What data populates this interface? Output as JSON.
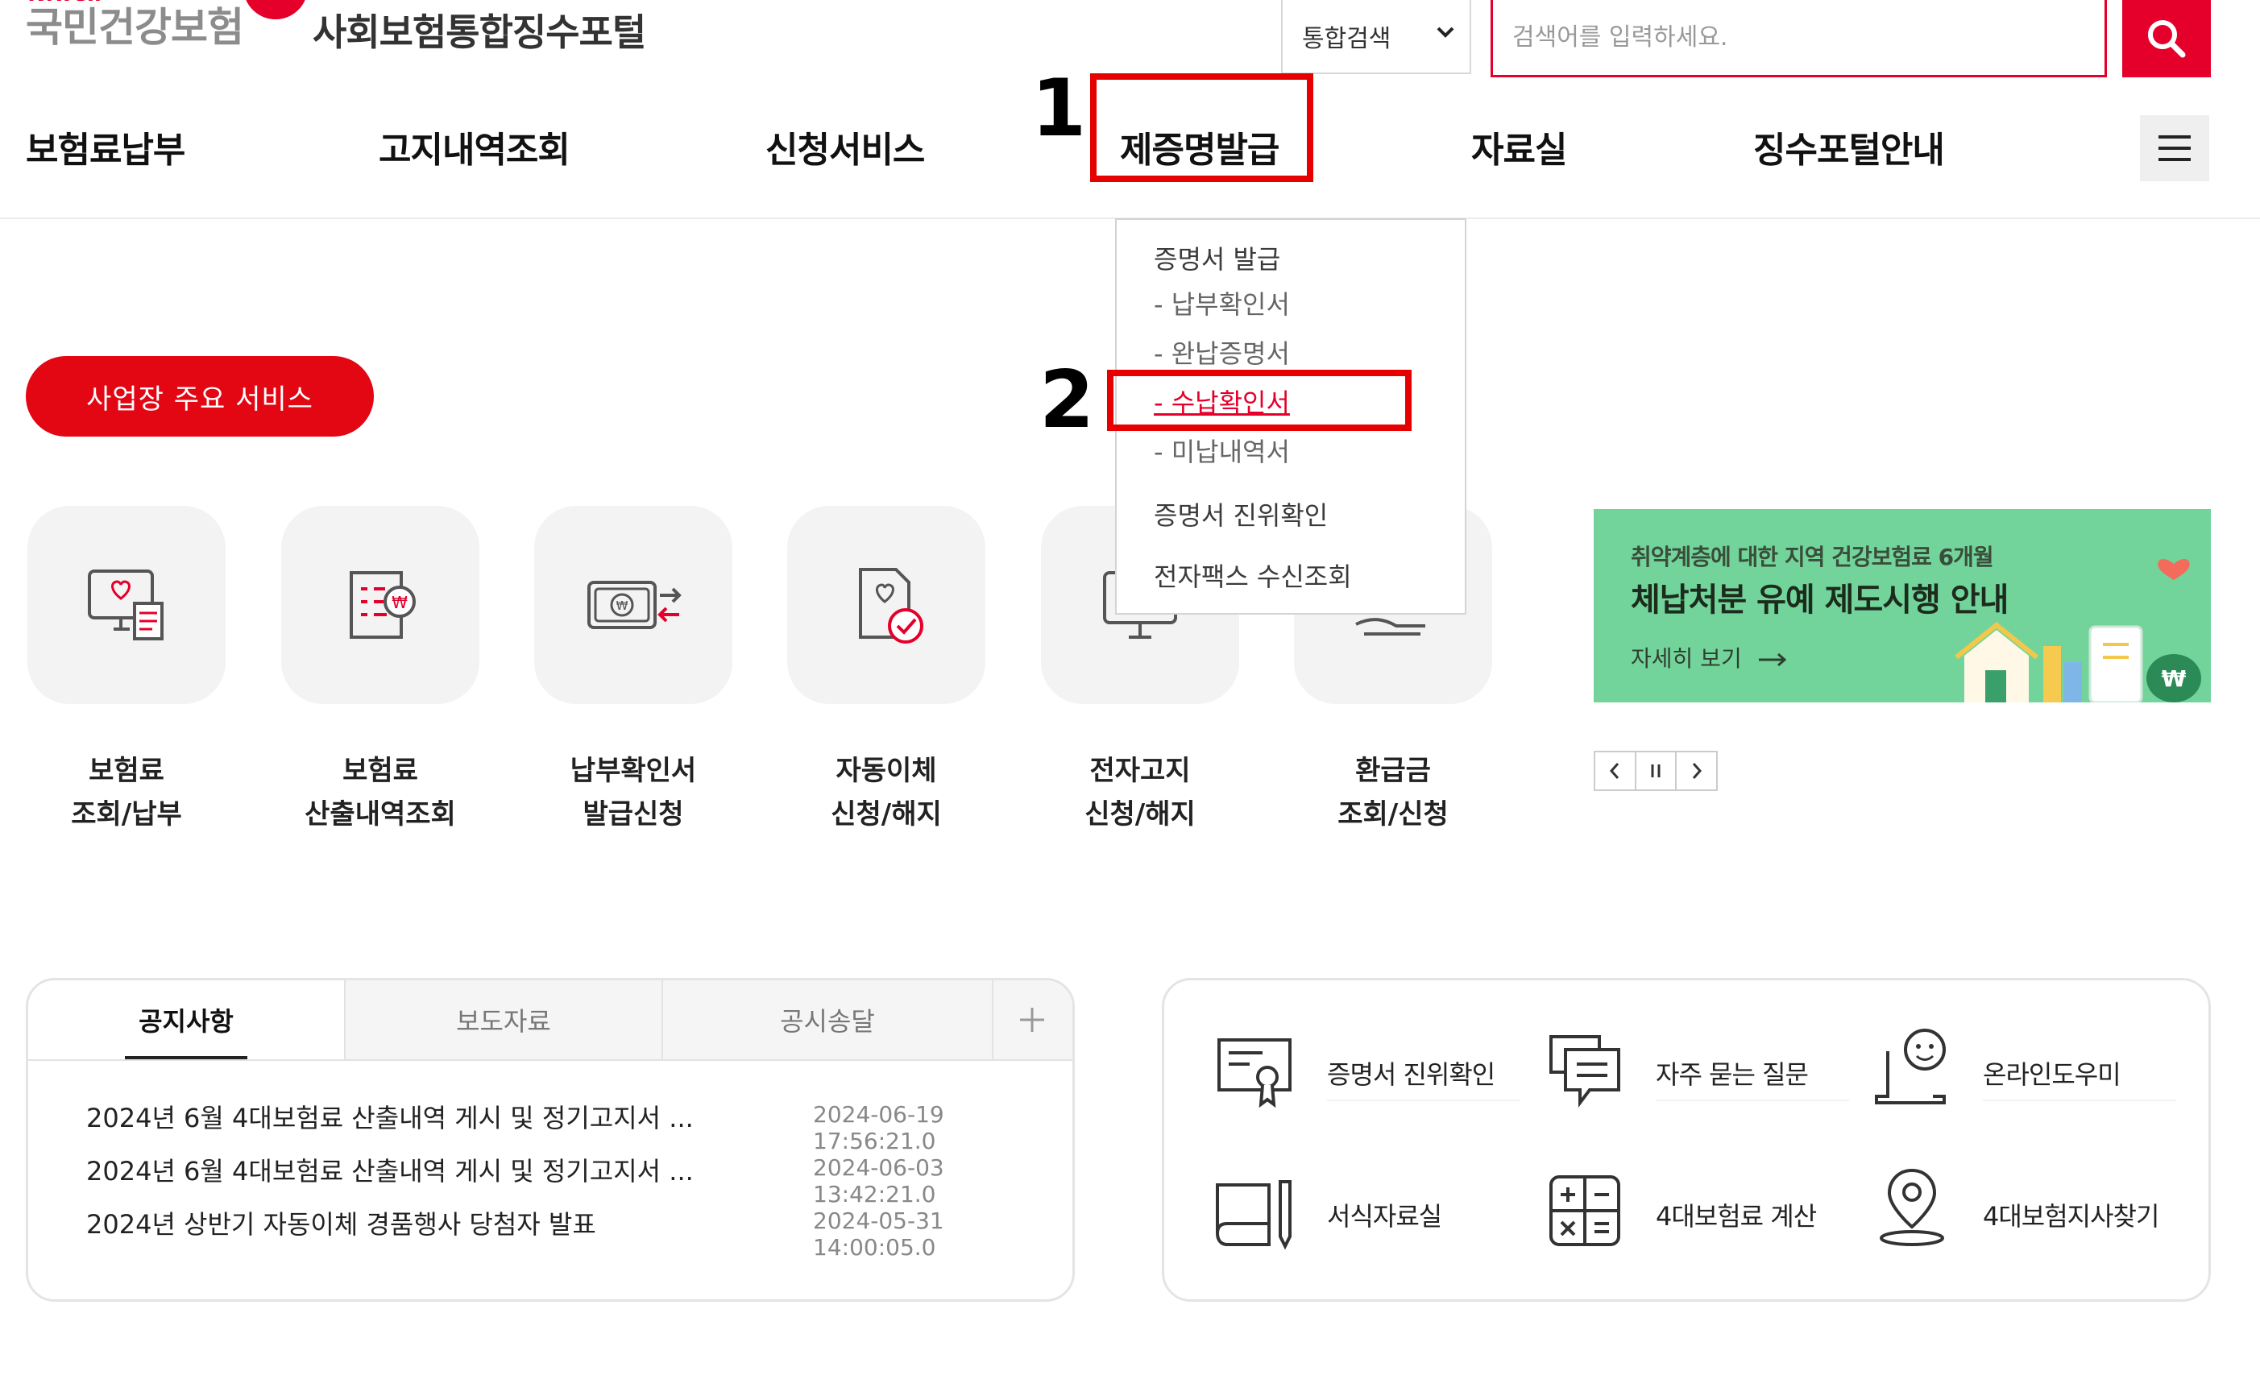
{
  "header": {
    "logo_small": "N.well",
    "logo_text": "국민건강보험",
    "portal_title": "사회보험통합징수포털",
    "search_scope": "통합검색",
    "search_placeholder": "검색어를 입력하세요.",
    "search_icon": "search-icon",
    "menu_icon": "hamburger-menu-icon"
  },
  "nav": {
    "items": [
      "보험료납부",
      "고지내역조회",
      "신청서비스",
      "제증명발급",
      "자료실",
      "징수포털안내"
    ]
  },
  "annotations": {
    "step1": "1",
    "step2": "2",
    "color": "#e60000"
  },
  "dropdown": {
    "section1": "증명서 발급",
    "items": [
      "- 납부확인서",
      "- 완납증명서",
      "- 수납확인서",
      "- 미납내역서"
    ],
    "selected": "- 수납확인서",
    "section2": "증명서 진위확인",
    "section3": "전자팩스 수신조회"
  },
  "service_button": "사업장 주요 서비스",
  "services": [
    {
      "label": "보험료\n조회/납부",
      "icon": "monitor-heart-receipt-icon"
    },
    {
      "label": "보험료\n산출내역조회",
      "icon": "document-won-icon"
    },
    {
      "label": "납부확인서\n발급신청",
      "icon": "card-won-transfer-icon"
    },
    {
      "label": "자동이체\n신청/해지",
      "icon": "document-heart-check-icon"
    },
    {
      "label": "전자고지\n신청/해지",
      "icon": "computer-monitor-icon"
    },
    {
      "label": "환급금\n조회/신청",
      "icon": "refund-hand-icon"
    }
  ],
  "banner": {
    "subtitle": "취약계층에 대한 지역 건강보험료 6개월",
    "title": "체납처분 유예 제도시행 안내",
    "more": "자세히 보기",
    "bg_color": "#72d49b",
    "controls": [
      "chevron-left-icon",
      "pause-icon",
      "chevron-right-icon"
    ]
  },
  "notices": {
    "tabs": [
      "공지사항",
      "보도자료",
      "공시송달"
    ],
    "plus_icon": "plus-icon",
    "rows": [
      {
        "title": "2024년 6월 4대보험료 산출내역 게시 및 정기고지서 ...",
        "date": "2024-06-19 17:56:21.0"
      },
      {
        "title": "2024년 6월 4대보험료 산출내역 게시 및 정기고지서 ...",
        "date": "2024-06-03 13:42:21.0"
      },
      {
        "title": "2024년 상반기 자동이체 경품행사 당첨자 발표",
        "date": "2024-05-31 14:00:05.0"
      }
    ]
  },
  "quick_links": [
    {
      "label": "증명서 진위확인",
      "icon": "certificate-icon"
    },
    {
      "label": "자주 묻는 질문",
      "icon": "chat-bubbles-icon"
    },
    {
      "label": "온라인도우미",
      "icon": "online-helper-icon"
    },
    {
      "label": "서식자료실",
      "icon": "book-pen-icon"
    },
    {
      "label": "4대보험료 계산",
      "icon": "calculator-icon"
    },
    {
      "label": "4대보험지사찾기",
      "icon": "location-pin-icon"
    }
  ],
  "colors": {
    "brand": "#e4002b",
    "pill": "#e30613"
  }
}
